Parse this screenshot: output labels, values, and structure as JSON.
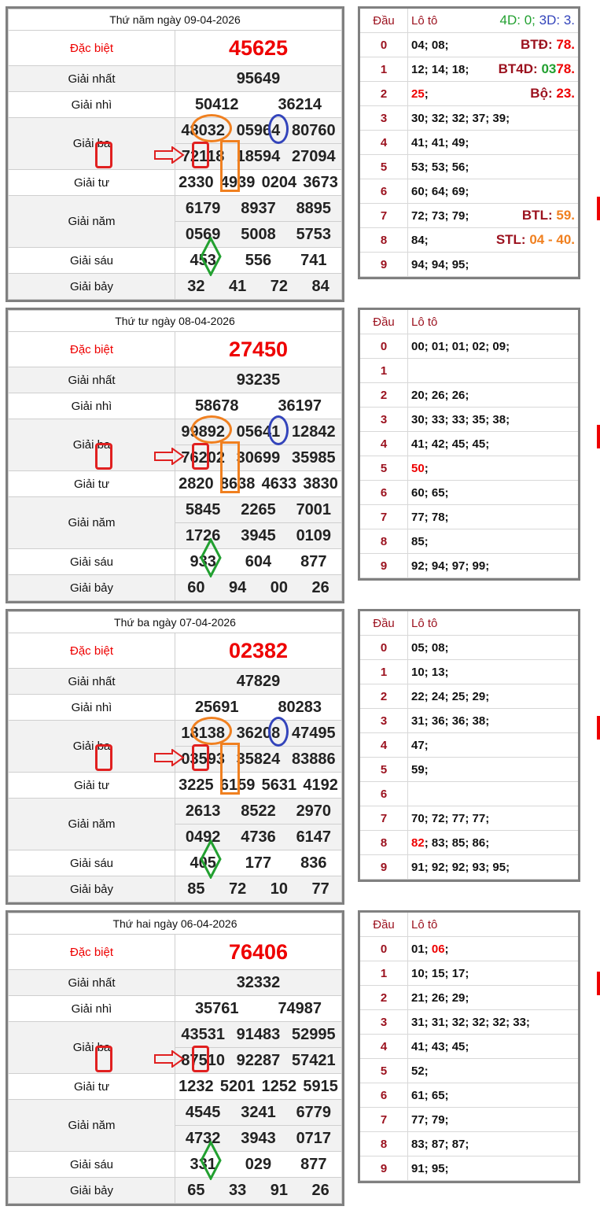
{
  "colors": {
    "red": "#e00000",
    "dark_red": "#9b111e",
    "green": "#22a030",
    "blue": "#3344bb",
    "orange": "#f08020"
  },
  "labels": {
    "db": "Đặc biệt",
    "g1": "Giải nhất",
    "g2": "Giải nhì",
    "g3": "Giải ba",
    "g4": "Giải tư",
    "g5": "Giải năm",
    "g6": "Giải sáu",
    "g7": "Giải bảy"
  },
  "loto_header": {
    "dau": "Đầu",
    "loto": "Lô tô"
  },
  "days": [
    {
      "title": "Thứ năm ngày 09-04-2026",
      "db": "45625",
      "g1": "95649",
      "g2": [
        "50412",
        "36214"
      ],
      "g3": [
        "48032",
        "05964",
        "80760",
        "72118",
        "18594",
        "27094"
      ],
      "g4": [
        "2330",
        "4939",
        "0204",
        "3673"
      ],
      "g5": [
        "6179",
        "8937",
        "8895",
        "0569",
        "5008",
        "5753"
      ],
      "g6": [
        "453",
        "556",
        "741"
      ],
      "g7": [
        "32",
        "41",
        "72",
        "84"
      ],
      "loto": [
        "04; 08;",
        "12; 14; 18;",
        "25;",
        "30; 32; 32; 37; 39;",
        "41; 41; 49;",
        "53; 53; 56;",
        "60; 64; 69;",
        "72; 73; 79;",
        "84;",
        "94; 94; 95;"
      ],
      "stats": {
        "s4d_label": "4D: 0;",
        "s3d_label": "3D: 3.",
        "btd_label": "BTĐ:",
        "btd_value": "78.",
        "bt4d_label": "BT4D:",
        "bt4d_v1": "03",
        "bt4d_v2": "78.",
        "bo_label": "Bộ:",
        "bo_value": "23.",
        "btl_label": "BTL:",
        "btl_value": "59.",
        "stl_label": "STL:",
        "stl_value": "04 - 40."
      }
    },
    {
      "title": "Thứ tư ngày 08-04-2026",
      "db": "27450",
      "g1": "93235",
      "g2": [
        "58678",
        "36197"
      ],
      "g3": [
        "99892",
        "05641",
        "12842",
        "76202",
        "30699",
        "35985"
      ],
      "g4": [
        "2820",
        "8638",
        "4633",
        "3830"
      ],
      "g5": [
        "5845",
        "2265",
        "7001",
        "1726",
        "3945",
        "0109"
      ],
      "g6": [
        "933",
        "604",
        "877"
      ],
      "g7": [
        "60",
        "94",
        "00",
        "26"
      ],
      "loto": [
        "00; 01; 01; 02; 09;",
        "",
        "20; 26; 26;",
        "30; 33; 33; 35; 38;",
        "41; 42; 45; 45;",
        "50;",
        "60; 65;",
        "77; 78;",
        "85;",
        "92; 94; 97; 99;"
      ]
    },
    {
      "title": "Thứ ba ngày 07-04-2026",
      "db": "02382",
      "g1": "47829",
      "g2": [
        "25691",
        "80283"
      ],
      "g3": [
        "18138",
        "36208",
        "47495",
        "03593",
        "35824",
        "83886"
      ],
      "g4": [
        "3225",
        "6159",
        "5631",
        "4192"
      ],
      "g5": [
        "2613",
        "8522",
        "2970",
        "0492",
        "4736",
        "6147"
      ],
      "g6": [
        "405",
        "177",
        "836"
      ],
      "g7": [
        "85",
        "72",
        "10",
        "77"
      ],
      "loto": [
        "05; 08;",
        "10; 13;",
        "22; 24; 25; 29;",
        "31; 36; 36; 38;",
        "47;",
        "59;",
        "",
        "70; 72; 77; 77;",
        "82; 83; 85; 86;",
        "91; 92; 92; 93; 95;"
      ]
    },
    {
      "title": "Thứ hai ngày 06-04-2026",
      "db": "76406",
      "g1": "32332",
      "g2": [
        "35761",
        "74987"
      ],
      "g3": [
        "43531",
        "91483",
        "52995",
        "87510",
        "92287",
        "57421"
      ],
      "g4": [
        "1232",
        "5201",
        "1252",
        "5915"
      ],
      "g5": [
        "4545",
        "3241",
        "6779",
        "4732",
        "3943",
        "0717"
      ],
      "g6": [
        "331",
        "029",
        "877"
      ],
      "g7": [
        "65",
        "33",
        "91",
        "26"
      ],
      "loto": [
        "01; 06;",
        "10; 15; 17;",
        "21; 26; 29;",
        "31; 31; 32; 32; 32; 33;",
        "41; 43; 45;",
        "52;",
        "61; 65;",
        "77; 79;",
        "83; 87; 87;",
        "91; 95;"
      ]
    }
  ]
}
